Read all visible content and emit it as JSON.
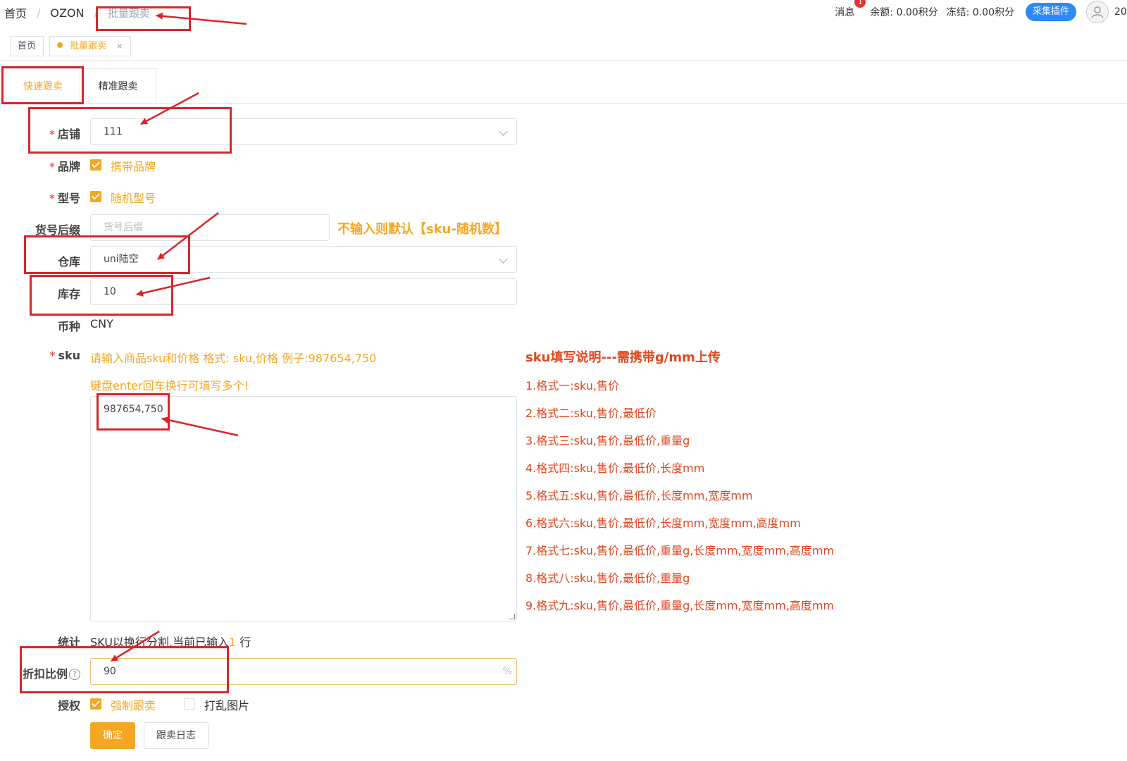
{
  "breadcrumb": {
    "home": "首页",
    "sep": "/",
    "section": "OZON",
    "current": "批量跟卖"
  },
  "topbar": {
    "messages": "消息",
    "message_badge": "1",
    "balance": "余额: 0.00积分",
    "frozen": "冻结: 0.00积分",
    "plugin_button": "采集插件",
    "user": "20"
  },
  "tags": {
    "home": "首页",
    "active": "批量跟卖",
    "close": "×"
  },
  "tabs": {
    "quick": "快速跟卖",
    "precise": "精准跟卖"
  },
  "form": {
    "store": {
      "label": "店铺",
      "required": "*",
      "value": "111"
    },
    "brand": {
      "label": "品牌",
      "required": "*",
      "option": "携带品牌"
    },
    "model": {
      "label": "型号",
      "required": "*",
      "option": "随机型号"
    },
    "sku_suffix": {
      "label": "货号后缀",
      "placeholder": "货号后缀",
      "hint": "不输入则默认【sku-随机数】"
    },
    "warehouse": {
      "label": "仓库",
      "value": "uni陆空"
    },
    "stock": {
      "label": "库存",
      "value": "10"
    },
    "currency": {
      "label": "币种",
      "value": "CNY"
    },
    "sku": {
      "label": "sku",
      "required": "*",
      "hint1": "请输入商品sku和价格 格式: sku,价格 例子:987654,750",
      "hint2": "键盘enter回车换行可填写多个!",
      "value": "987654,750"
    },
    "stats": {
      "label": "统计",
      "text_before": "SKU以换行分割,当前已输入",
      "count": "1",
      "text_after": " 行"
    },
    "discount": {
      "label": "折扣比例",
      "help": "?",
      "value": "90",
      "suffix": "%"
    },
    "auth": {
      "label": "授权",
      "force": "强制跟卖",
      "shuffle": "打乱图片"
    },
    "confirm_button": "确定",
    "log_button": "跟卖日志"
  },
  "rules": {
    "title": "sku填写说明---需携带g/mm上传",
    "items": [
      "1.格式一:sku,售价",
      "2.格式二:sku,售价,最低价",
      "3.格式三:sku,售价,最低价,重量g",
      "4.格式四:sku,售价,最低价,长度mm",
      "5.格式五:sku,售价,最低价,长度mm,宽度mm",
      "6.格式六:sku,售价,最低价,长度mm,宽度mm,高度mm",
      "7.格式七:sku,售价,最低价,重量g,长度mm,宽度mm,高度mm",
      "8.格式八:sku,售价,最低价,重量g",
      "9.格式九:sku,售价,最低价,重量g,长度mm,宽度mm,高度mm"
    ]
  },
  "colors": {
    "accent": "#f5a623",
    "rule_red": "#e2461e",
    "annotation_red": "#d9262b",
    "plugin_blue": "#2b8af5"
  }
}
